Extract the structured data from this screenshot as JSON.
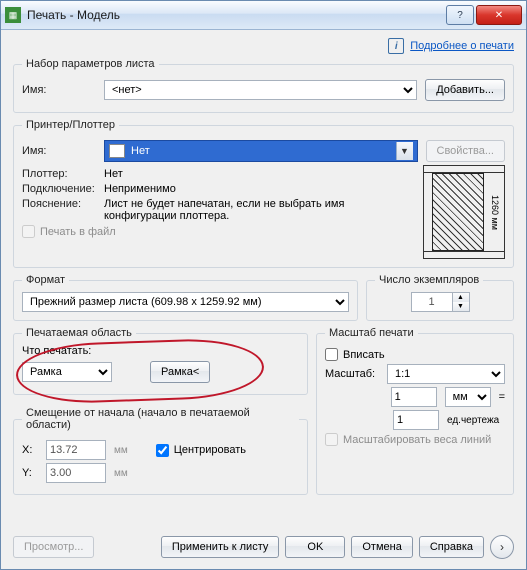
{
  "window": {
    "title": "Печать - Модель"
  },
  "help_link": "Подробнее о печати",
  "page_setup": {
    "legend": "Набор параметров листа",
    "name_label": "Имя:",
    "name_value": "<нет>",
    "add_button": "Добавить..."
  },
  "printer": {
    "legend": "Принтер/Плоттер",
    "name_label": "Имя:",
    "name_value": "Нет",
    "props_button": "Свойства...",
    "plotter_label": "Плоттер:",
    "plotter_value": "Нет",
    "conn_label": "Подключение:",
    "conn_value": "Неприменимо",
    "desc_label": "Пояснение:",
    "desc_value": "Лист не будет напечатан, если не выбрать имя конфигурации плоттера.",
    "to_file": "Печать в файл",
    "dim_text": "1260 мм"
  },
  "paper": {
    "legend": "Формат",
    "value": "Прежний размер листа (609.98 x 1259.92 мм)"
  },
  "copies": {
    "legend": "Число экземпляров",
    "value": "1"
  },
  "area": {
    "legend": "Печатаемая область",
    "what_label": "Что печатать:",
    "what_value": "Рамка",
    "window_button": "Рамка<"
  },
  "scale": {
    "legend": "Масштаб печати",
    "fit": "Вписать",
    "label": "Масштаб:",
    "value": "1:1",
    "num": "1",
    "unit": "мм",
    "eq": "=",
    "den": "1",
    "den_unit": "ед.чертежа",
    "lw": "Масштабировать веса линий"
  },
  "offset": {
    "legend": "Смещение от начала (начало в печатаемой области)",
    "x_label": "X:",
    "x_value": "13.72",
    "y_label": "Y:",
    "y_value": "3.00",
    "unit": "мм",
    "center": "Центрировать"
  },
  "footer": {
    "preview": "Просмотр...",
    "apply": "Применить к листу",
    "ok": "OK",
    "cancel": "Отмена",
    "help": "Справка"
  }
}
